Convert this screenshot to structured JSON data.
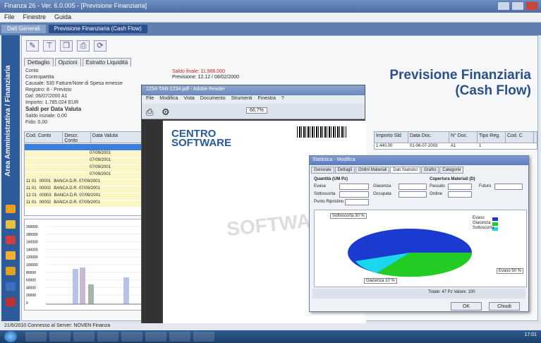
{
  "window": {
    "title": "Finanza 26 - Ver. 6.0.005 - [Previsione Finanziaria]",
    "menu": [
      "File",
      "Finestre",
      "Guida"
    ]
  },
  "tabs": [
    "Dati Generali",
    "Previsione Finanziaria (Cash Flow)"
  ],
  "sidebar": {
    "label": "Area Amministrativa / Finanziaria"
  },
  "subtabs": [
    "Dettaglio",
    "Opzioni",
    "Estratto Liquidità"
  ],
  "info": {
    "lines": [
      "Conto",
      "Contropartita",
      "Causale: 530 Fatture/Note di Spesa emesse",
      "Registro: 8 - Previsto",
      "Dal: 06/07/2000    A1",
      "Importo: 1.785.024 EUR",
      "Saldi per Data Valuta",
      "Saldo iniziale: 0,00",
      "Fido: 0,00"
    ],
    "highlight": "Saldo finale: 11.986.000",
    "note": "Previsione: 12.12 / 08/02/2000"
  },
  "heading": {
    "line1": "Previsione Finanziaria",
    "line2": "(Cash Flow)"
  },
  "grid": {
    "headers": [
      "Cod. Conto",
      "Descr. Conto",
      "Data Valuta"
    ],
    "rows": [
      [
        "",
        "",
        ""
      ],
      [
        "",
        "",
        "07/09/2001"
      ],
      [
        "",
        "",
        "07/09/2001"
      ],
      [
        "",
        "",
        "07/09/2001"
      ],
      [
        "",
        "",
        "07/09/2001"
      ],
      [
        "11 01",
        "00001",
        "BANCA D.R. 07/09/2001"
      ],
      [
        "11 01",
        "00002",
        "BANCA D.R. 07/09/2001"
      ],
      [
        "12 01",
        "00003",
        "BANCA D.R. 07/09/2001"
      ],
      [
        "11 01",
        "00002",
        "BANCA D.R. 07/09/2001"
      ]
    ]
  },
  "rightgrid": {
    "headers": [
      "Importo Sld",
      "Data Doc.",
      "N° Doc.",
      "Tipo Reg.",
      "Cod. C"
    ],
    "row": [
      "1.440,00",
      "01-06-07-2003",
      "A1",
      "1",
      ""
    ]
  },
  "pdf": {
    "title": "1234-TAR-1234.pdf - Adobe Reader",
    "menu": [
      "File",
      "Modifica",
      "Vista",
      "Documento",
      "Strumenti",
      "Finestra",
      "?"
    ],
    "zoom": "66,7%",
    "logo": "CENTRO",
    "logo2": "SOFTWARE",
    "watermark": "SOFTWARE"
  },
  "dialog": {
    "title": "Statistica - Modifica",
    "tabs": [
      "Generale",
      "Dettagli",
      "Ordini Materiali",
      "Dati Statistici",
      "Grafici",
      "Categorie"
    ],
    "left_title": "Quantità (UM Pz)",
    "right_title": "Copertura Materiali (D)",
    "fields": [
      "Evasa",
      "Giacenza",
      "Sottoscorta",
      "Occupata",
      "Punto Ripristino",
      "Passato",
      "Futuro",
      "Ordine"
    ],
    "pie_labels": [
      "Sottoscorta 30 %",
      "Evaso 50 %",
      "Giacenza 10 %"
    ],
    "legend": [
      "Evaso",
      "Giacenza",
      "Sottoscorta"
    ],
    "bottom": "Totale: 47 Pz   Valore: 100",
    "buttons": [
      "OK",
      "Chiudi"
    ]
  },
  "status": "21/6/2010   Connesso al Server: NOVEN   Finanza",
  "clock": "17:01",
  "chart_axis": [
    "200000",
    "180000",
    "160000",
    "140000",
    "120000",
    "100000",
    "80000",
    "60000",
    "40000",
    "20000",
    "0"
  ]
}
